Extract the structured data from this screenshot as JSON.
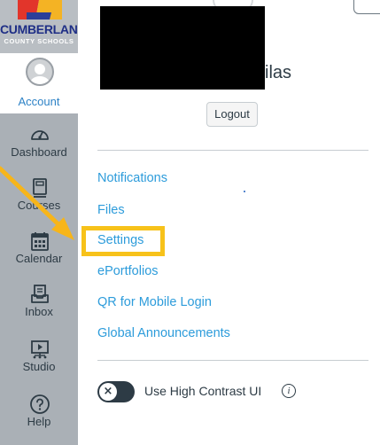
{
  "branding": {
    "logo_line1": "CUMBERLAND",
    "logo_line2": "COUNTY SCHOOLS"
  },
  "nav": {
    "account": {
      "label": "Account",
      "icon": "avatar-icon"
    },
    "items": [
      {
        "label": "Dashboard",
        "icon": "dashboard-gauge-icon"
      },
      {
        "label": "Courses",
        "icon": "courses-book-icon"
      },
      {
        "label": "Calendar",
        "icon": "calendar-icon"
      },
      {
        "label": "Inbox",
        "icon": "inbox-icon"
      },
      {
        "label": "Studio",
        "icon": "studio-presentation-icon"
      },
      {
        "label": "Help",
        "icon": "help-question-icon"
      }
    ]
  },
  "profile": {
    "name_visible_fragment": "ilas",
    "logout_label": "Logout"
  },
  "menu": {
    "links": [
      {
        "label": "Notifications"
      },
      {
        "label": "Files"
      },
      {
        "label": "Settings"
      },
      {
        "label": "ePortfolios"
      },
      {
        "label": "QR for Mobile Login"
      },
      {
        "label": "Global Announcements"
      }
    ],
    "highlighted_index": 2
  },
  "contrast_toggle": {
    "label": "Use High Contrast UI",
    "state": "off",
    "knob_glyph": "×",
    "info_glyph": "i"
  },
  "colors": {
    "rail_background": "#aab0b6",
    "link": "#2d9cdb",
    "highlight": "#f7c21a",
    "text": "#2d3b45"
  }
}
